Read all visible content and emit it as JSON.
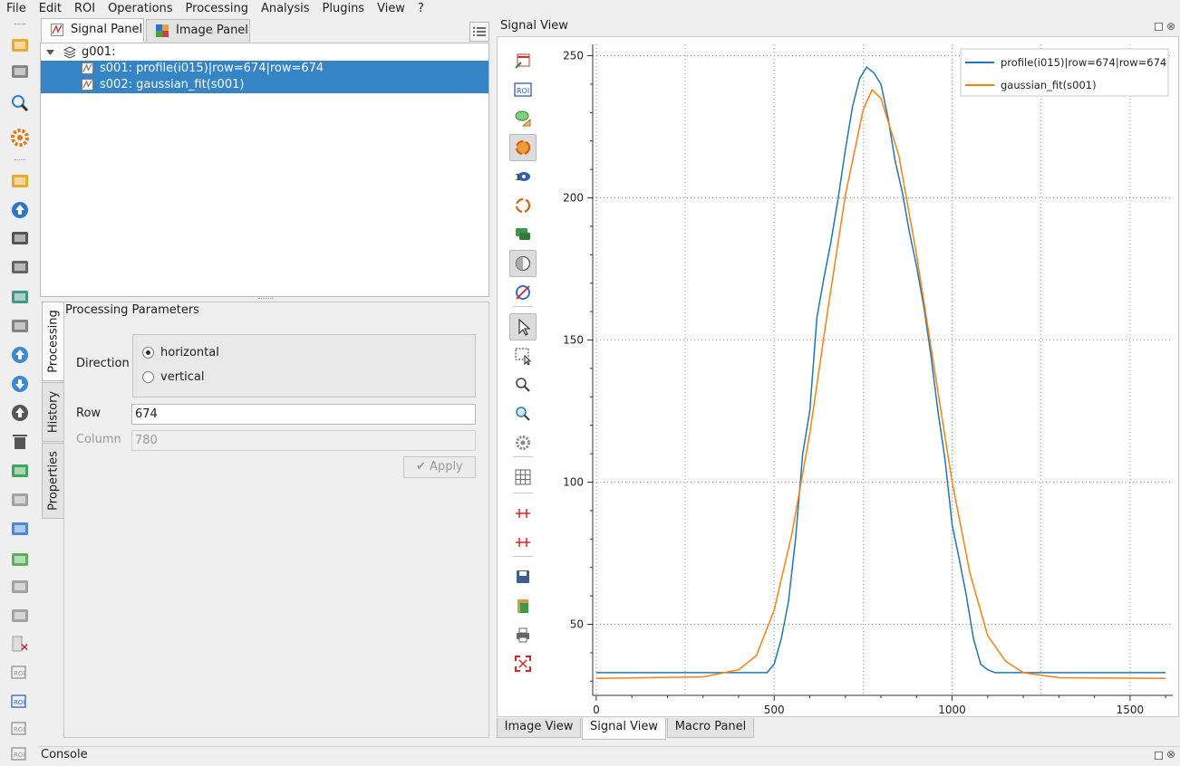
{
  "menu": [
    "File",
    "Edit",
    "ROI",
    "Operations",
    "Processing",
    "Analysis",
    "Plugins",
    "View",
    "?"
  ],
  "left_toolbar": {
    "icons": [
      "open-h5-icon",
      "save-h5-icon",
      "browse-h5-icon",
      "settings-icon",
      "open-signal-icon",
      "upload-icon",
      "save-signal-icon",
      "save-all-icon",
      "memory-icon",
      "import-icon",
      "move-up-icon",
      "move-down-icon",
      "duplicate-icon",
      "delete-icon",
      "truck-icon",
      "copy-metadata-icon",
      "paste-metadata-icon",
      "add-metadata-icon",
      "import-metadata-icon",
      "export-metadata-icon",
      "delete-metadata-icon",
      "roi-edit-icon",
      "roi-copy-icon",
      "roi-paste-icon",
      "roi-delete-icon"
    ]
  },
  "panel_tabs": {
    "signal": "Signal Panel",
    "image": "Image Panel"
  },
  "tree": {
    "group": "g001:",
    "items": [
      "s001: profile(i015)|row=674|row=674",
      "s002: gaussian_fit(s001)"
    ]
  },
  "side_tabs": {
    "processing": "Processing",
    "history": "History",
    "properties": "Properties"
  },
  "params": {
    "title": "Processing Parameters",
    "direction_label": "Direction",
    "horizontal": "horizontal",
    "vertical": "vertical",
    "row_label": "Row",
    "row_value": "674",
    "column_label": "Column",
    "column_value": "780",
    "apply": "Apply"
  },
  "signal_view_title": "Signal View",
  "plot_toolbar": {
    "icons": [
      "new-signal-icon",
      "roi-icon",
      "annotation-icon",
      "autoscale-icon",
      "reverse-x-icon",
      "refresh-icon",
      "comment-icon",
      "contrast-icon",
      "target-icon",
      "select-pointer-icon",
      "rect-zoom-icon",
      "zoom-icon",
      "zoom-fit-icon",
      "gear-icon",
      "grid-icon",
      "x-cross-icon",
      "y-cross-icon",
      "save-icon",
      "copy-icon",
      "print-icon",
      "fullscreen-icon"
    ]
  },
  "bottom_tabs": {
    "image_view": "Image View",
    "signal_view": "Signal View",
    "macro_panel": "Macro Panel"
  },
  "console_title": "Console",
  "colors": {
    "selection": "#3584c6",
    "series1": "#1f77b4",
    "series2": "#ff7f0e"
  },
  "chart_data": {
    "type": "line",
    "xlim": [
      -10,
      1620
    ],
    "ylim": [
      25,
      254
    ],
    "xticks": [
      0,
      500,
      1000,
      1500
    ],
    "yticks": [
      50,
      100,
      150,
      200,
      250
    ],
    "grid": true,
    "legend": "top-right",
    "series": [
      {
        "name": "profile(i015)|row=674|row=674",
        "x": [
          0,
          480,
          500,
          520,
          540,
          560,
          580,
          600,
          620,
          640,
          660,
          680,
          700,
          720,
          740,
          760,
          780,
          800,
          820,
          840,
          860,
          880,
          900,
          920,
          940,
          960,
          980,
          1000,
          1020,
          1040,
          1060,
          1080,
          1100,
          1120,
          1600
        ],
        "y": [
          33,
          33,
          36,
          45,
          58,
          80,
          110,
          125,
          158,
          172,
          185,
          200,
          217,
          232,
          242,
          246,
          244,
          240,
          228,
          213,
          202,
          188,
          176,
          162,
          145,
          125,
          108,
          85,
          73,
          60,
          45,
          36,
          34,
          33,
          33
        ]
      },
      {
        "name": "gaussian_fit(s001)",
        "x": [
          0,
          300,
          400,
          450,
          500,
          550,
          600,
          650,
          700,
          750,
          775,
          800,
          850,
          900,
          950,
          1000,
          1050,
          1100,
          1150,
          1200,
          1300,
          1600
        ],
        "y": [
          31,
          31.5,
          34,
          39,
          55,
          82,
          117,
          160,
          201,
          231,
          238,
          235,
          215,
          180,
          140,
          100,
          68,
          46,
          37,
          33,
          31.2,
          31
        ]
      }
    ]
  }
}
